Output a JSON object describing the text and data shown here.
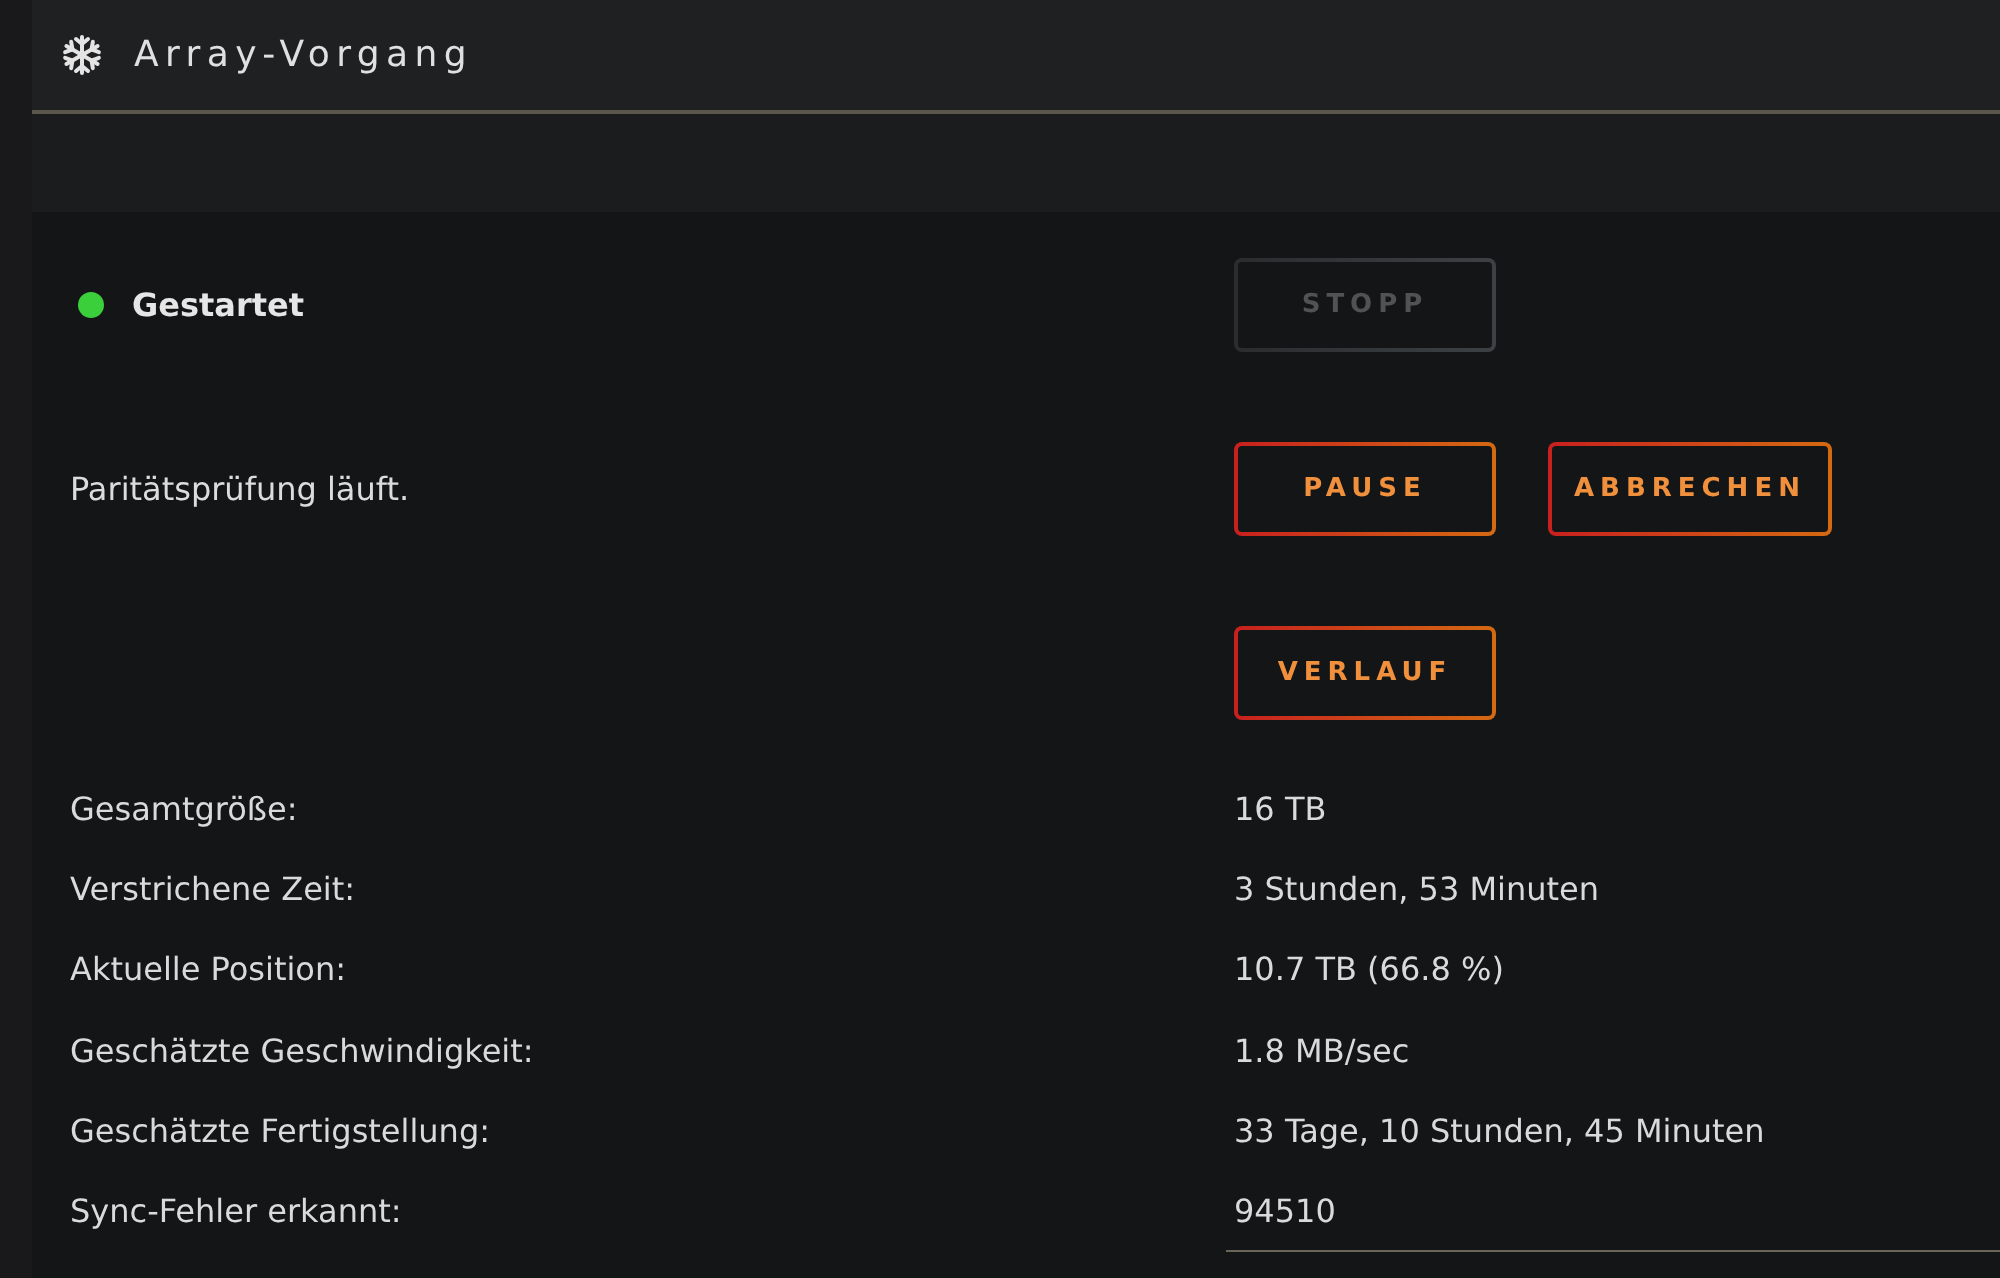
{
  "header": {
    "title": "Array-Vorgang"
  },
  "actions": [
    {
      "kind": "status",
      "text": "Gestartet",
      "color": "#3ccf3c",
      "buttons": [
        {
          "label": "STOPP",
          "disabled": true
        }
      ]
    },
    {
      "kind": "message",
      "text": "Paritätsprüfung läuft.",
      "buttons": [
        {
          "label": "PAUSE",
          "disabled": false
        },
        {
          "label": "ABBRECHEN",
          "disabled": false
        }
      ]
    },
    {
      "kind": "empty",
      "buttons": [
        {
          "label": "VERLAUF",
          "disabled": false
        }
      ]
    }
  ],
  "details": [
    {
      "label": "Gesamtgröße:",
      "value": "16 TB"
    },
    {
      "label": "Verstrichene Zeit:",
      "value": "3 Stunden, 53 Minuten"
    },
    {
      "label": "Aktuelle Position:",
      "value": "10.7 TB (66.8 %)"
    },
    {
      "label": "Geschätzte Geschwindigkeit:",
      "value": "1.8 MB/sec"
    },
    {
      "label": "Geschätzte Fertigstellung:",
      "value": "33 Tage, 10 Stunden, 45 Minuten"
    },
    {
      "label": "Sync-Fehler erkannt:",
      "value": "94510"
    }
  ]
}
